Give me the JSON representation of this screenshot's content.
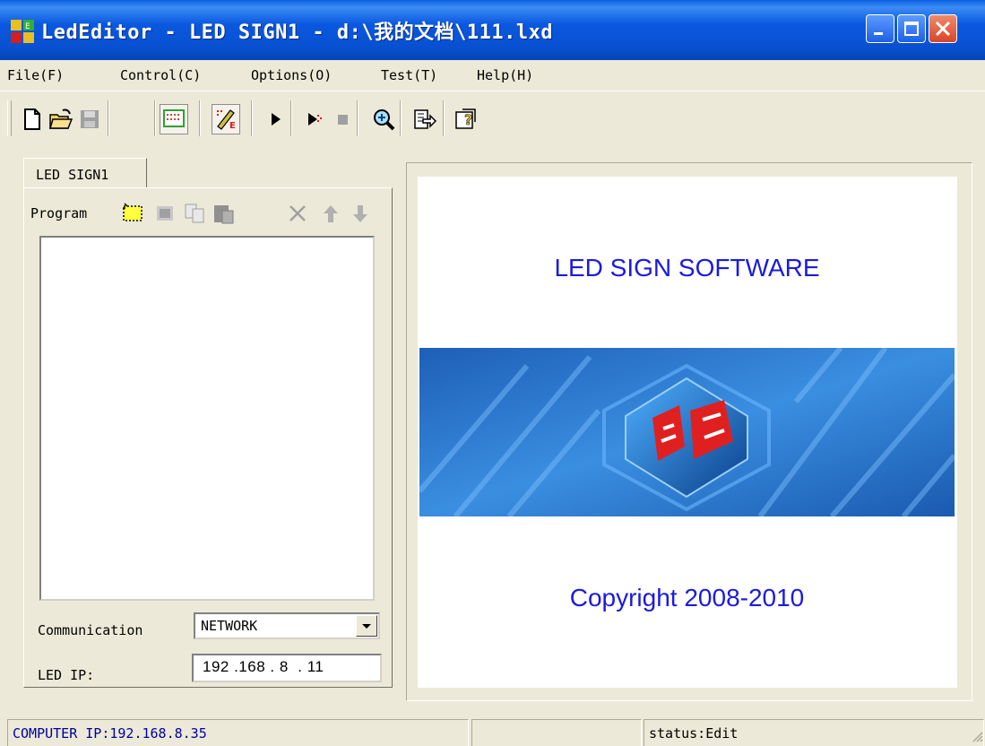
{
  "window": {
    "title": "LedEditor - LED SIGN1 - d:\\我的文档\\111.lxd",
    "controls": [
      "minimize-icon",
      "maximize-icon",
      "close-icon"
    ],
    "title_colors": {
      "bar": "#0a58e0",
      "text": "#ffffff"
    }
  },
  "menu": {
    "items": [
      {
        "label": "File(F)"
      },
      {
        "label": "Control(C)"
      },
      {
        "label": "Options(O)"
      },
      {
        "label": "Test(T)"
      },
      {
        "label": "Help(H)"
      }
    ]
  },
  "toolbar": {
    "icons": [
      "new-file-icon",
      "open-folder-icon",
      "save-icon",
      "screen-setup-icon",
      "edit-mode-icon",
      "play-icon",
      "play-step-icon",
      "stop-icon",
      "zoom-icon",
      "export-icon",
      "help-icon"
    ]
  },
  "left_panel": {
    "tab_label": "LED SIGN1",
    "program_label": "Program",
    "program_icons": [
      "new-program-icon",
      "new-area-icon",
      "copy-icon",
      "paste-icon",
      "delete-icon",
      "move-up-icon",
      "move-down-icon"
    ],
    "communication_label": "Communication",
    "communication_value": "NETWORK",
    "ip_label": "LED IP:",
    "ip_value": "192 .168 . 8  . 11"
  },
  "preview": {
    "title": "LED SIGN SOFTWARE",
    "copyright": "Copyright 2008-2010",
    "text_color": "#1a1ae0"
  },
  "statusbar": {
    "computer_ip": "COMPUTER IP:192.168.8.35",
    "middle": "",
    "status": "status:Edit"
  }
}
